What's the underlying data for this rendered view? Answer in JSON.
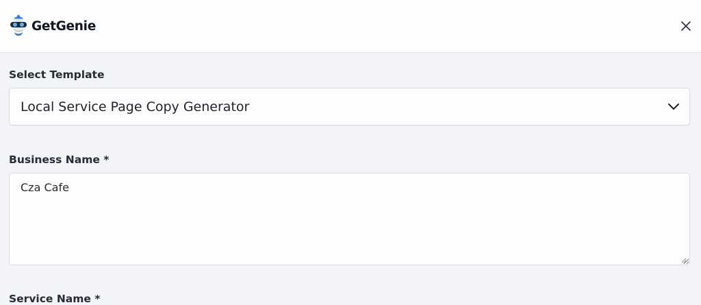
{
  "header": {
    "brand_name": "GetGenie",
    "logo_icon": "genie-mascot-icon",
    "close_icon": "close-icon"
  },
  "form": {
    "template": {
      "label": "Select Template",
      "selected_value": "Local Service Page Copy Generator",
      "dropdown_icon": "chevron-down-icon"
    },
    "business_name": {
      "label": "Business Name *",
      "value": "Cza Cafe"
    },
    "service_name": {
      "label": "Service Name *"
    }
  },
  "colors": {
    "page_background": "#f3f4f8",
    "header_background": "#fcfdfc",
    "input_border": "#d9dce3",
    "text_primary": "#1d222c"
  }
}
